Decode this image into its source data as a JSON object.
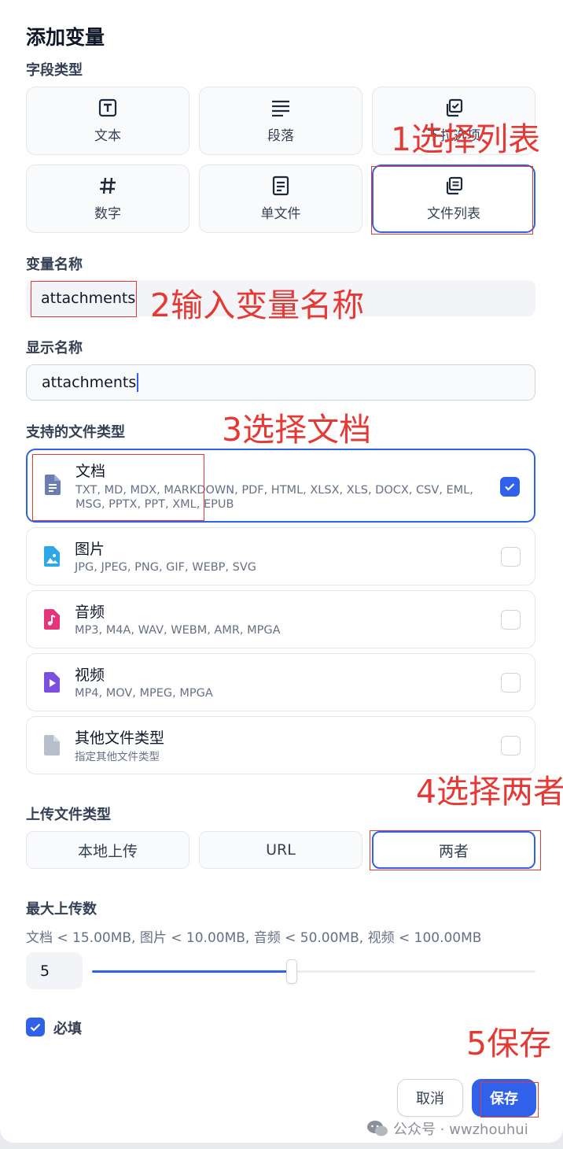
{
  "dialog": {
    "title": "添加变量",
    "field_type_label": "字段类型",
    "field_types": [
      {
        "label": "文本",
        "icon": "text-type-icon"
      },
      {
        "label": "段落",
        "icon": "paragraph-icon"
      },
      {
        "label": "下拉选项",
        "icon": "select-icon"
      },
      {
        "label": "数字",
        "icon": "hash-icon"
      },
      {
        "label": "单文件",
        "icon": "file-icon"
      },
      {
        "label": "文件列表",
        "icon": "file-list-icon"
      }
    ],
    "selected_field_type": "文件列表",
    "variable_name_label": "变量名称",
    "variable_name_value": "attachments",
    "display_name_label": "显示名称",
    "display_name_value": "attachments",
    "file_types_label": "支持的文件类型",
    "file_types": [
      {
        "name": "文档",
        "desc": "TXT, MD, MDX, MARKDOWN, PDF, HTML, XLSX, XLS, DOCX, CSV, EML, MSG, PPTX, PPT, XML, EPUB",
        "checked": true,
        "color": "#6b7db3"
      },
      {
        "name": "图片",
        "desc": "JPG, JPEG, PNG, GIF, WEBP, SVG",
        "checked": false,
        "color": "#2ea8e5"
      },
      {
        "name": "音频",
        "desc": "MP3, M4A, WAV, WEBM, AMR, MPGA",
        "checked": false,
        "color": "#e6347a"
      },
      {
        "name": "视频",
        "desc": "MP4, MOV, MPEG, MPGA",
        "checked": false,
        "color": "#7b4fe0"
      },
      {
        "name": "其他文件类型",
        "desc": "指定其他文件类型",
        "checked": false,
        "color": "#b8bfcc"
      }
    ],
    "upload_method_label": "上传文件类型",
    "upload_methods": [
      "本地上传",
      "URL",
      "两者"
    ],
    "selected_upload_method": "两者",
    "max_upload_label": "最大上传数",
    "max_upload_limits": "文档 < 15.00MB, 图片 < 10.00MB, 音频 < 50.00MB, 视频 < 100.00MB",
    "max_upload_value": "5",
    "max_upload_slider_fraction": 0.45,
    "required_label": "必填",
    "required_checked": true,
    "cancel_label": "取消",
    "save_label": "保存"
  },
  "annotations": {
    "step1": "1选择列表",
    "step2": "2输入变量名称",
    "step3": "3选择文档",
    "step4": "4选择两者",
    "step5": "5保存"
  },
  "watermark": "公众号 · wwzhouhui",
  "colors": {
    "accent": "#2f61ea",
    "annotation": "#e53935"
  }
}
